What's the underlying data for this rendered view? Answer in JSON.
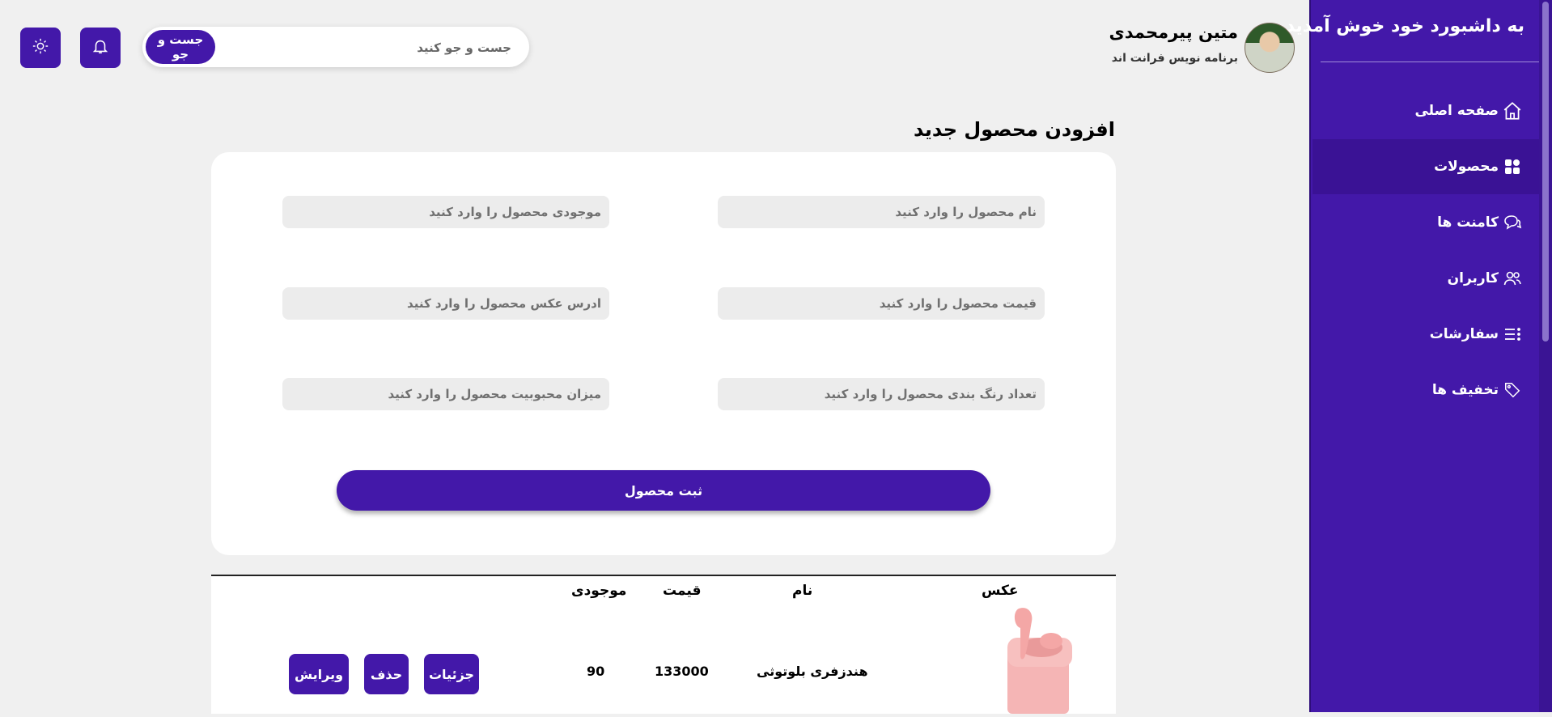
{
  "sidebar": {
    "title": "به داشبورد خود خوش آمدید",
    "items": [
      {
        "label": "صفحه اصلی",
        "icon": "home-icon"
      },
      {
        "label": "محصولات",
        "icon": "grid-icon"
      },
      {
        "label": "کامنت ها",
        "icon": "comments-icon"
      },
      {
        "label": "کاربران",
        "icon": "users-icon"
      },
      {
        "label": "سفارشات",
        "icon": "list-icon"
      },
      {
        "label": "تخفیف ها",
        "icon": "tag-icon"
      }
    ],
    "active_index": 1
  },
  "header": {
    "user_name": "متین پیرمحمدی",
    "user_role": "برنامه نویس فرانت اند",
    "search_placeholder": "جست و جو کنید",
    "search_button": "جست و جو"
  },
  "form": {
    "title": "افزودن محصول جدید",
    "fields": {
      "name": "نام محصول را وارد کنید",
      "stock": "موجودی محصول را وارد کنید",
      "price": "قیمت محصول را وارد کنید",
      "image": "ادرس عکس محصول را وارد کنید",
      "colors": "تعداد رنگ بندی محصول را وارد کنید",
      "popularity": "میزان محبوبیت محصول را وارد کنید"
    },
    "submit": "ثبت محصول"
  },
  "table": {
    "headers": {
      "image": "عکس",
      "name": "نام",
      "price": "قیمت",
      "stock": "موجودی"
    },
    "rows": [
      {
        "name": "هندزفری بلوتوثی",
        "price": "133000",
        "stock": "90",
        "actions": {
          "details": "جزئیات",
          "delete": "حذف",
          "edit": "ویرایش"
        }
      }
    ]
  },
  "colors": {
    "primary": "#4318a9",
    "active": "#3a1295",
    "background": "#f0f0f0"
  }
}
